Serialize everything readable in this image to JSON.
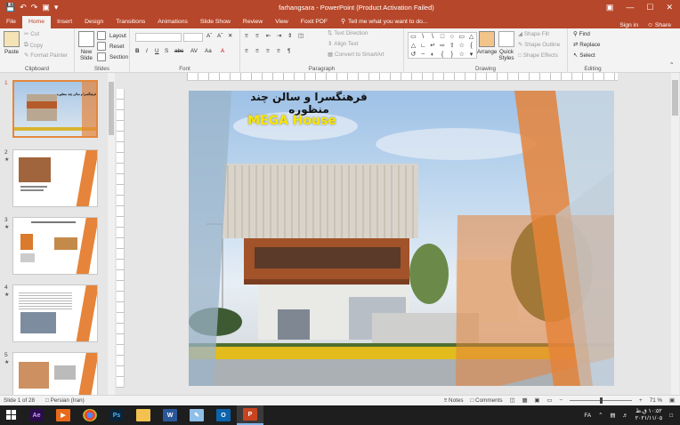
{
  "window": {
    "title": "farhangsara - PowerPoint (Product Activation Failed)",
    "controls": [
      "—",
      "☐",
      "✕"
    ]
  },
  "tabs": [
    "File",
    "Home",
    "Insert",
    "Design",
    "Transitions",
    "Animations",
    "Slide Show",
    "Review",
    "View",
    "Foxit PDF"
  ],
  "tell_me": "Tell me what you want to do...",
  "account": {
    "sign_in": "Sign in",
    "share": "Share"
  },
  "ribbon": {
    "clipboard": {
      "label": "Clipboard",
      "paste": "Paste",
      "cut": "Cut",
      "copy": "Copy",
      "format_painter": "Format Painter"
    },
    "slides": {
      "label": "Slides",
      "new_slide_1": "New",
      "new_slide_2": "Slide",
      "layout": "Layout",
      "reset": "Reset",
      "section": "Section"
    },
    "font": {
      "label": "Font"
    },
    "paragraph": {
      "label": "Paragraph",
      "text_direction": "Text Direction",
      "align_text": "Align Text",
      "convert": "Convert to SmartArt"
    },
    "drawing": {
      "label": "Drawing",
      "arrange": "Arrange",
      "quick_styles_1": "Quick",
      "quick_styles_2": "Styles",
      "shape_fill": "Shape Fill",
      "shape_outline": "Shape Outline",
      "shape_effects": "Shape Effects"
    },
    "editing": {
      "label": "Editing",
      "find": "Find",
      "replace": "Replace",
      "select": "Select"
    }
  },
  "thumbnails": [
    {
      "num": "1",
      "title": "فرهنگسرا و سالن چند منظوره"
    },
    {
      "num": "2",
      "title": ""
    },
    {
      "num": "3",
      "title": ""
    },
    {
      "num": "4",
      "title": ""
    },
    {
      "num": "5",
      "title": ""
    }
  ],
  "slide": {
    "title": "فرهنگسرا و سالن چند منظوره",
    "subtitle": "MEGA House"
  },
  "status": {
    "slide_of": "Slide 1 of 28",
    "language": "Persian (Iran)",
    "notes": "Notes",
    "comments": "Comments",
    "zoom": "71 %"
  },
  "taskbar": {
    "apps": [
      "Ae",
      "",
      "",
      "Ps",
      "",
      "W",
      "",
      "O",
      "P"
    ],
    "lang": "FA",
    "time": "١٠:٥٢ ق.ظ",
    "date": "٢٠٢١/١١/٠٥"
  },
  "colors": {
    "accent": "#b7472a",
    "ribbon_bg": "#f3f3f3",
    "slide_orange": "#e5843a",
    "subtitle_yellow": "#f7e600"
  }
}
